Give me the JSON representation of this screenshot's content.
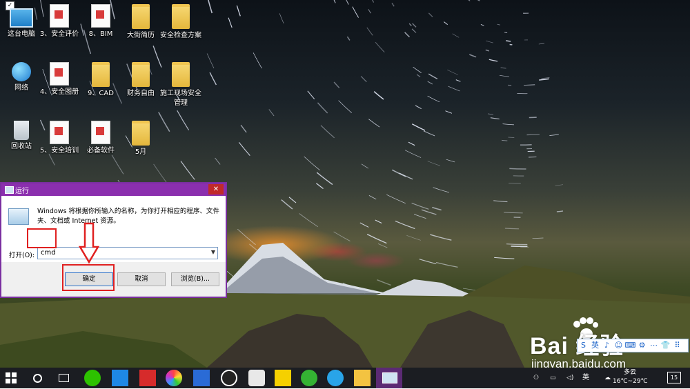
{
  "desktop": {
    "icons": [
      {
        "id": "this-pc",
        "label": "这台电脑",
        "icon": "computer-icon"
      },
      {
        "id": "s3",
        "label": "3、安全评价",
        "icon": "document-icon"
      },
      {
        "id": "s8",
        "label": "8、BIM",
        "icon": "document-icon"
      },
      {
        "id": "dajie",
        "label": "大街简历",
        "icon": "folder-icon"
      },
      {
        "id": "checklist",
        "label": "安全检查方案",
        "icon": "folder-icon"
      },
      {
        "id": "network",
        "label": "网络",
        "icon": "network-icon"
      },
      {
        "id": "s4",
        "label": "4、安全图册",
        "icon": "document-icon"
      },
      {
        "id": "s9",
        "label": "9、CAD",
        "icon": "folder-icon"
      },
      {
        "id": "finance",
        "label": "财务自由",
        "icon": "folder-icon"
      },
      {
        "id": "site",
        "label": "施工现场安全管理",
        "icon": "folder-icon"
      },
      {
        "id": "recycle",
        "label": "回收站",
        "icon": "recycle-bin-icon"
      },
      {
        "id": "s5",
        "label": "5、安全培训",
        "icon": "document-icon"
      },
      {
        "id": "software",
        "label": "必备软件",
        "icon": "document-icon"
      },
      {
        "id": "may",
        "label": "5月",
        "icon": "folder-icon"
      }
    ]
  },
  "run_dialog": {
    "title": "运行",
    "close": "✕",
    "description": "Windows 将根据你所输入的名称，为你打开相应的程序、文件夹、文档或 Internet 资源。",
    "open_label": "打开(O):",
    "input_value": "cmd",
    "ok_label": "确定",
    "cancel_label": "取消",
    "browse_label": "浏览(B)..."
  },
  "watermark": {
    "brand": "Bai 经验",
    "url": "jingyan.baidu.com"
  },
  "ime_toolbar": {
    "items": [
      "S",
      "英",
      "♪",
      "☺",
      "⌨",
      "⚙",
      "⋯",
      "👕",
      "⠿"
    ]
  },
  "taskbar": {
    "ime_mode": "英",
    "weather": {
      "condition": "多云",
      "range": "16℃~29℃"
    },
    "notifications": "15"
  },
  "colors": {
    "dialog_title": "#8b2fae",
    "highlight": "#e02020",
    "taskbar": "#1b1d22"
  }
}
